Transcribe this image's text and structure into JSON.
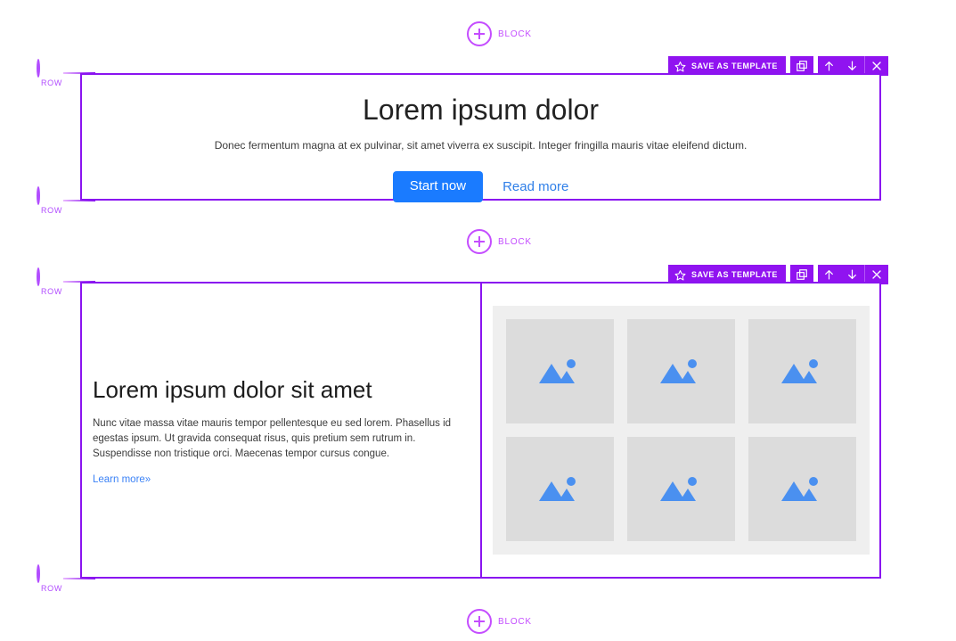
{
  "editor": {
    "add_block_label": "BLOCK",
    "add_row_label": "ROW",
    "accent_purple": "#8a14f0",
    "accent_light_purple": "#c44dff",
    "toolbar": {
      "save_as_template_label": "SAVE AS TEMPLATE",
      "star_icon": "star-icon",
      "duplicate_icon": "duplicate-icon",
      "move_up_icon": "arrow-up-icon",
      "move_down_icon": "arrow-down-icon",
      "delete_icon": "close-icon"
    }
  },
  "rows": [
    {
      "type": "hero",
      "title": "Lorem ipsum dolor",
      "subtitle": "Donec fermentum magna at ex pulvinar, sit amet viverra ex suscipit. Integer fringilla mauris vitae eleifend dictum.",
      "primary_button": "Start now",
      "secondary_link": "Read more",
      "primary_button_color": "#1a7bff",
      "secondary_link_color": "#2f7fe8"
    },
    {
      "type": "text-and-gallery",
      "title": "Lorem ipsum dolor sit amet",
      "body": "Nunc vitae massa vitae mauris tempor pellentesque eu sed lorem. Phasellus id egestas ipsum. Ut gravida consequat risus, quis pretium sem rutrum in. Suspendisse non tristique orci. Maecenas tempor cursus congue.",
      "link": "Learn more»",
      "link_color": "#3b82f6",
      "gallery": {
        "columns": 3,
        "rows": 2,
        "count": 6,
        "placeholder_icon": "image-placeholder-icon",
        "tile_color": "#dcdcdc",
        "background_color": "#efefef",
        "icon_color": "#4a90f0"
      }
    }
  ]
}
